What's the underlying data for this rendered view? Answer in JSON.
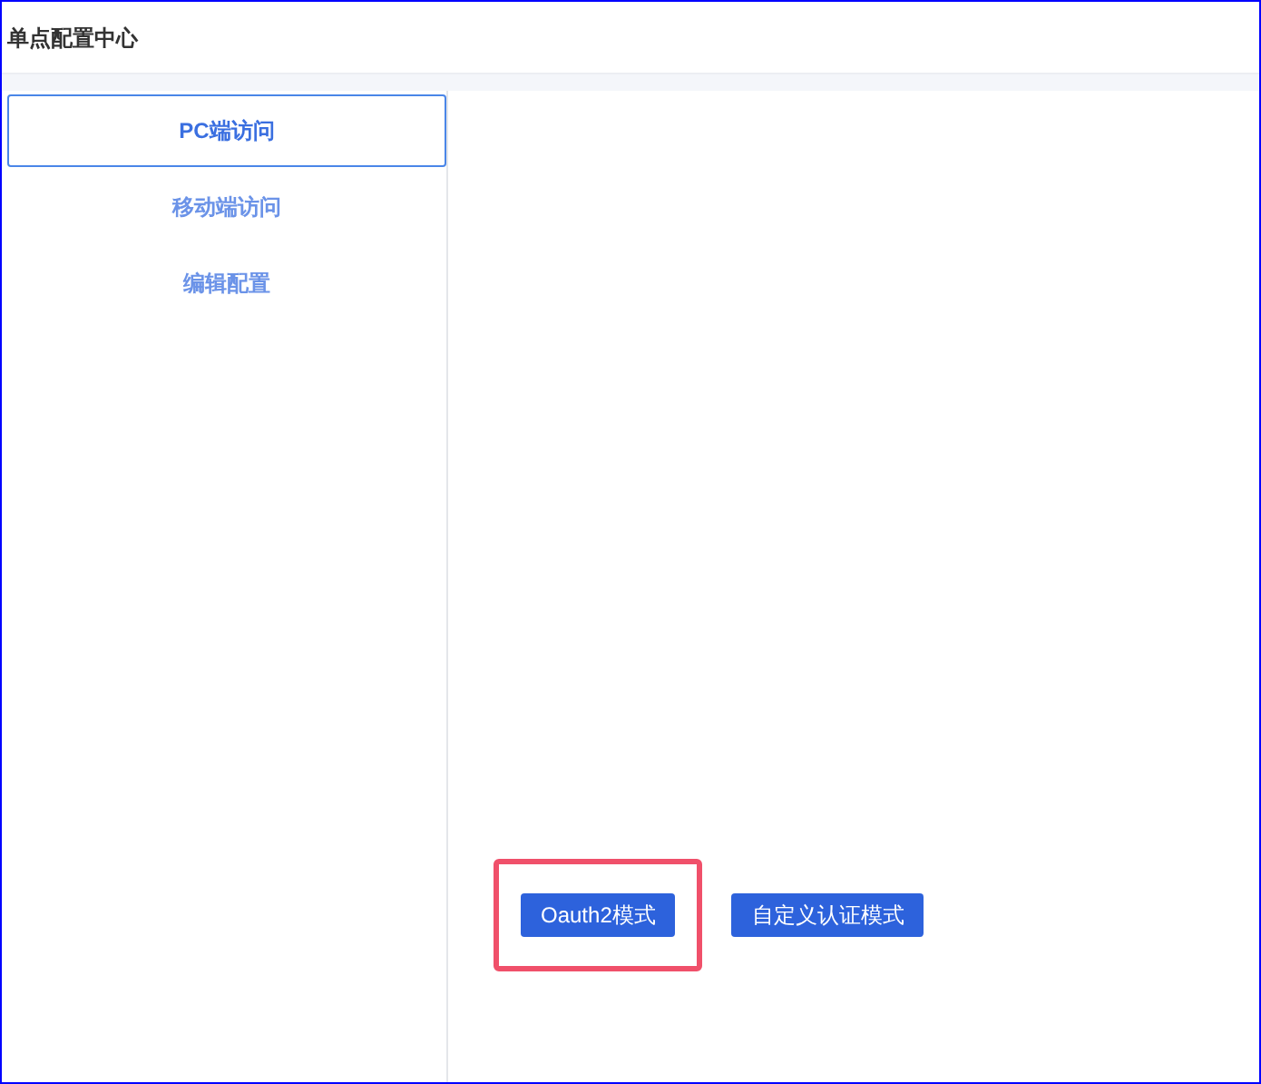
{
  "header": {
    "title": "单点配置中心"
  },
  "sidebar": {
    "items": [
      {
        "label": "PC端访问",
        "selected": true
      },
      {
        "label": "移动端访问",
        "selected": false
      },
      {
        "label": "编辑配置",
        "selected": false
      }
    ]
  },
  "buttons": [
    {
      "label": "Oauth2模式",
      "highlighted": true
    },
    {
      "label": "自定义认证模式",
      "highlighted": false
    }
  ]
}
